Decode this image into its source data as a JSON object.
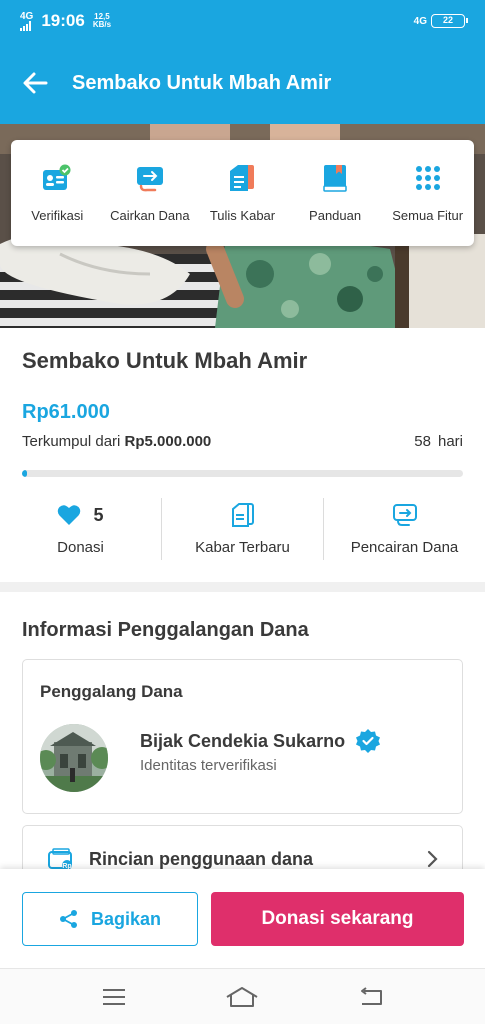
{
  "status_bar": {
    "network_left": "4G",
    "time": "19:06",
    "speed_value": "12,5",
    "speed_unit": "KB/s",
    "network_right": "4G",
    "battery": "22"
  },
  "app_bar": {
    "title": "Sembako Untuk Mbah Amir"
  },
  "features": [
    {
      "label": "Verifikasi",
      "icon": "verification-id-icon"
    },
    {
      "label": "Cairkan Dana",
      "icon": "withdraw-funds-icon"
    },
    {
      "label": "Tulis Kabar",
      "icon": "write-update-icon"
    },
    {
      "label": "Panduan",
      "icon": "guide-book-icon"
    },
    {
      "label": "Semua Fitur",
      "icon": "grid-dots-icon"
    }
  ],
  "campaign": {
    "title": "Sembako Untuk Mbah Amir",
    "amount": "Rp61.000",
    "collected_prefix": "Terkumpul dari",
    "target": "Rp5.000.000",
    "days_left": "58",
    "days_unit": "hari",
    "progress_percent": 1.22
  },
  "stats": [
    {
      "icon": "heart-icon",
      "count": "5",
      "label": "Donasi"
    },
    {
      "icon": "news-update-icon",
      "count": "",
      "label": "Kabar Terbaru"
    },
    {
      "icon": "withdrawal-icon",
      "count": "",
      "label": "Pencairan Dana"
    }
  ],
  "info": {
    "section_title": "Informasi Penggalangan Dana",
    "card_heading": "Penggalang Dana",
    "fundraiser_name": "Bijak Cendekia Sukarno",
    "fundraiser_status": "Identitas terverifikasi",
    "detail_label": "Rincian penggunaan dana"
  },
  "actions": {
    "share_label": "Bagikan",
    "donate_label": "Donasi sekarang"
  },
  "colors": {
    "primary": "#1aa6e0",
    "donate": "#df2f6b",
    "verified_badge": "#1aa6e0"
  }
}
